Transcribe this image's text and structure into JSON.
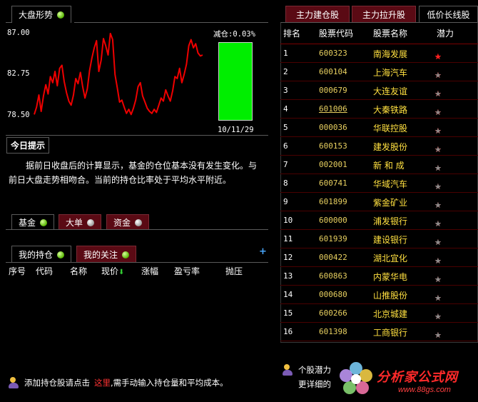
{
  "market": {
    "tab_label": "大盘形势",
    "y_labels": [
      "87.00",
      "82.75",
      "78.50"
    ],
    "reduce_label": "减仓:0.03%",
    "position_ratio": 1.0,
    "date": "10/11/29",
    "line_color": "#ee0000",
    "bar_color": "#00ee00"
  },
  "chart_data": {
    "type": "line",
    "ylim": [
      78.5,
      87.0
    ],
    "series": [
      {
        "values": [
          78.9,
          79.6,
          80.8,
          79.2,
          80.7,
          81.8,
          80.9,
          82.6,
          82.0,
          83.1,
          81.7,
          83.4,
          83.7,
          82.1,
          81.0,
          80.2,
          79.8,
          80.8,
          82.4,
          81.9,
          83.0,
          81.6,
          80.5,
          81.4,
          83.2,
          84.4,
          85.4,
          86.1,
          83.1,
          84.2,
          86.3,
          85.6,
          84.7,
          86.8,
          86.2,
          82.8,
          81.5,
          80.1,
          80.3,
          79.6,
          79.0,
          79.4,
          78.9,
          79.5,
          80.3,
          81.6,
          82.0,
          80.7,
          80.1,
          79.5,
          79.2,
          79.0,
          79.4,
          79.1,
          79.8,
          80.5,
          80.2,
          81.3,
          80.7,
          80.2,
          81.2,
          82.6,
          82.4,
          83.4,
          82.0,
          82.8,
          83.8,
          85.6,
          86.2,
          85.4,
          85.8,
          84.9,
          84.6,
          84.7
        ]
      }
    ]
  },
  "hint": {
    "title": "今日提示",
    "text": "据前日收盘后的计算显示，基金的仓位基本没有发生变化。与前日大盘走势相吻合。当前的持仓比率处于平均水平附近。"
  },
  "fund_tabs": [
    {
      "label": "基金",
      "dot": "green"
    },
    {
      "label": "大单",
      "dot": "gray"
    },
    {
      "label": "资金",
      "dot": "gray"
    }
  ],
  "watch_tabs": [
    {
      "label": "我的持仓",
      "dot": "green"
    },
    {
      "label": "我的关注",
      "dot": "green"
    }
  ],
  "holdings_columns": [
    "序号",
    "代码",
    "名称",
    "现价",
    "涨幅",
    "盈亏率",
    "抛压"
  ],
  "plus_icon": "+",
  "bottom_tip": {
    "before": "添加持仓股请点击",
    "link": "这里",
    "after": ",需手动输入持仓量和平均成本。"
  },
  "right_tabs": [
    {
      "label": "主力建仓股",
      "active": false
    },
    {
      "label": "主力拉升股",
      "active": false
    },
    {
      "label": "低价长线股",
      "active": true
    }
  ],
  "right_columns": [
    "排名",
    "股票代码",
    "股票名称",
    "潜力"
  ],
  "stocks": [
    {
      "rank": "1",
      "code": "600323",
      "name": "南海发展",
      "stars": 5
    },
    {
      "rank": "2",
      "code": "600104",
      "name": "上海汽车",
      "stars": 4
    },
    {
      "rank": "3",
      "code": "000679",
      "name": "大连友谊",
      "stars": 4
    },
    {
      "rank": "4",
      "code": "601006",
      "name": "大秦铁路",
      "stars": 4,
      "underline": true
    },
    {
      "rank": "5",
      "code": "000036",
      "name": "华联控股",
      "stars": 4
    },
    {
      "rank": "6",
      "code": "600153",
      "name": "建发股份",
      "stars": 4
    },
    {
      "rank": "7",
      "code": "002001",
      "name": "新 和 成",
      "stars": 3
    },
    {
      "rank": "8",
      "code": "600741",
      "name": "华域汽车",
      "stars": 3
    },
    {
      "rank": "9",
      "code": "601899",
      "name": "紫金矿业",
      "stars": 3
    },
    {
      "rank": "10",
      "code": "600000",
      "name": "浦发银行",
      "stars": 3
    },
    {
      "rank": "11",
      "code": "601939",
      "name": "建设银行",
      "stars": 3
    },
    {
      "rank": "12",
      "code": "000422",
      "name": "湖北宜化",
      "stars": 3
    },
    {
      "rank": "13",
      "code": "600863",
      "name": "内蒙华电",
      "stars": 3
    },
    {
      "rank": "14",
      "code": "000680",
      "name": "山推股份",
      "stars": 3
    },
    {
      "rank": "15",
      "code": "600266",
      "name": "北京城建",
      "stars": 3
    },
    {
      "rank": "16",
      "code": "601398",
      "name": "工商银行",
      "stars": 3
    }
  ],
  "right_tip": {
    "line1": "个股潜力",
    "line2": "更详细的"
  },
  "watermark": {
    "title": "分析家公式网",
    "url": "www.88gs.com"
  }
}
